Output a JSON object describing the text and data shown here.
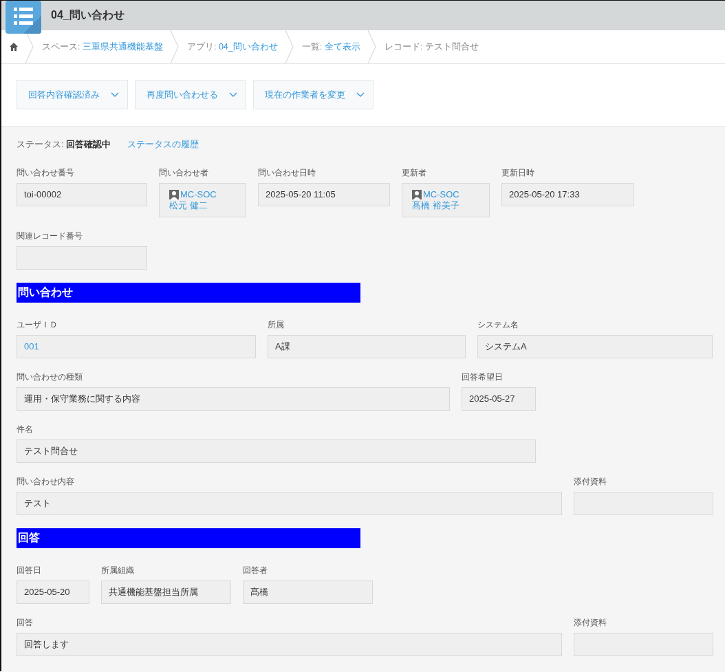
{
  "app": {
    "title": "04_問い合わせ"
  },
  "breadcrumb": [
    {
      "kind": "home"
    },
    {
      "kind": "link",
      "prefix": "スペース: ",
      "link": "三重県共通機能基盤"
    },
    {
      "kind": "link",
      "prefix": "アプリ: ",
      "link": "04_問い合わせ"
    },
    {
      "kind": "link",
      "prefix": "一覧: ",
      "link": "全て表示"
    },
    {
      "kind": "plain",
      "text": "レコード: テスト問合せ"
    }
  ],
  "actions": [
    "回答内容確認済み",
    "再度問い合わせる",
    "現在の作業者を変更"
  ],
  "status": {
    "text": "ステータス: **回答確認中**",
    "history_link": "ステータスの履歴"
  },
  "sections": [
    {
      "kind": "plain",
      "lines": [
        {
          "fields": [
            {
              "label": "問い合わせ番号",
              "kind": "text",
              "value": "toi-00002"
            },
            {
              "label": "問い合わせ者",
              "kind": "user",
              "org": "MC-SOC",
              "name": "松元 健二"
            },
            {
              "label": "問い合わせ日時",
              "kind": "text",
              "value": "2025-05-20 11:05"
            },
            {
              "label": "更新者",
              "kind": "user",
              "org": "MC-SOC",
              "name": "髙橋 裕美子"
            },
            {
              "label": "更新日時",
              "kind": "text",
              "value": "2025-05-20 17:33"
            }
          ]
        },
        {
          "fields": [
            {
              "label": "関連レコード番号",
              "kind": "empty"
            }
          ]
        }
      ]
    },
    {
      "kind": "group",
      "title": "問い合わせ",
      "lines": [
        {
          "fields": [
            {
              "label": "ユーザＩＤ",
              "kind": "link",
              "value": "001"
            },
            {
              "label": "所属",
              "kind": "text",
              "value": "A課"
            },
            {
              "label": "システム名",
              "kind": "text",
              "value": "システムA"
            }
          ]
        },
        {
          "fields": [
            {
              "label": "問い合わせの種類",
              "kind": "text",
              "value": "運用・保守業務に関する内容"
            },
            {
              "label": "回答希望日",
              "kind": "text",
              "value": "2025-05-27"
            }
          ]
        },
        {
          "fields": [
            {
              "label": "件名",
              "kind": "text",
              "value": "テスト問合せ"
            }
          ]
        },
        {
          "fields": [
            {
              "label": "問い合わせ内容",
              "kind": "text",
              "value": "テスト"
            },
            {
              "label": "添付資料",
              "kind": "empty"
            }
          ]
        }
      ]
    },
    {
      "kind": "group",
      "title": "回答",
      "lines": [
        {
          "fields": [
            {
              "label": "回答日",
              "kind": "text",
              "value": "2025-05-20"
            },
            {
              "label": "所属組織",
              "kind": "text",
              "value": "共通機能基盤担当所属"
            },
            {
              "label": "回答者",
              "kind": "text",
              "value": "髙橋"
            }
          ]
        },
        {
          "fields": [
            {
              "label": "回答",
              "kind": "text",
              "value": "回答します"
            },
            {
              "label": "添付資料",
              "kind": "empty"
            }
          ]
        }
      ]
    }
  ]
}
